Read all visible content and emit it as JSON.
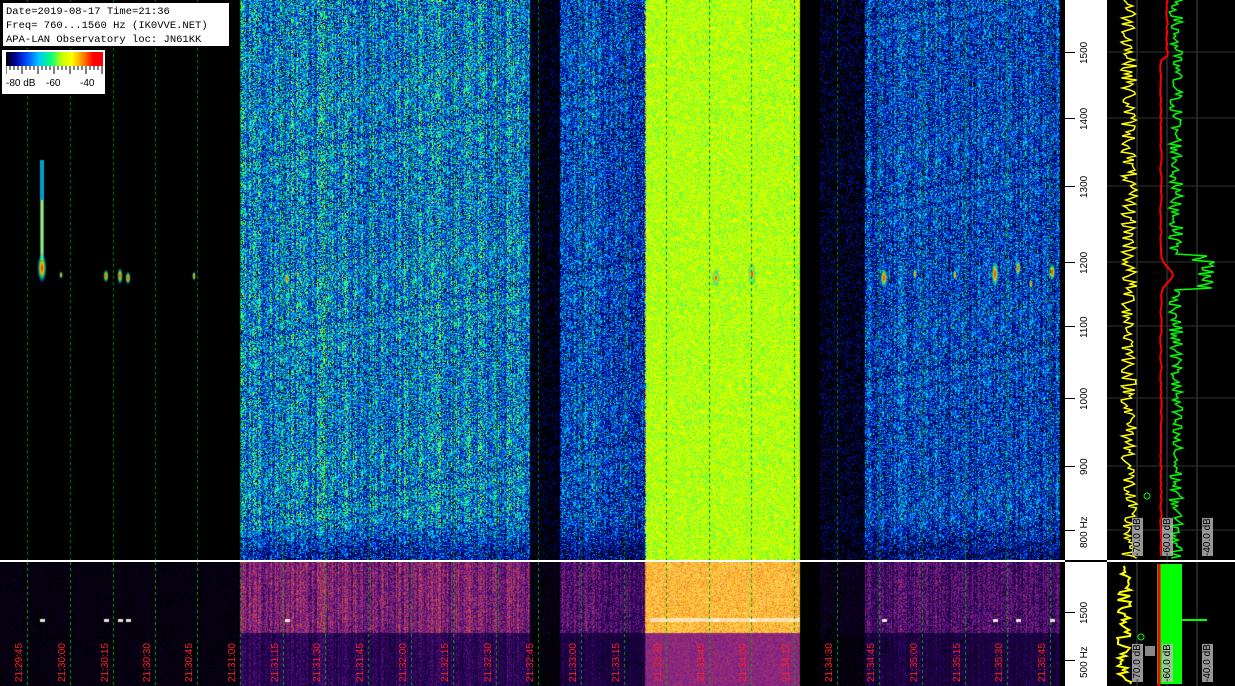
{
  "info": {
    "line1": "Date=2019-08-17 Time=21:36",
    "line2": "Freq= 760...1560 Hz (IK0VVE.NET)",
    "line3": "APA-LAN Observatory loc: JN61KK"
  },
  "scale": {
    "label_min": "-80 dB",
    "label_mid": "-60",
    "label_max": "-40"
  },
  "freq_axis": {
    "ticks": [
      "1500",
      "1400",
      "1300",
      "1200",
      "1100",
      "1000",
      "900",
      "800 Hz"
    ],
    "bottom_ticks": [
      "1500",
      "500 Hz"
    ]
  },
  "time_axis": {
    "labels": [
      "21:29:45",
      "21:30:00",
      "21:30:15",
      "21:30:30",
      "21:30:45",
      "21:31:00",
      "21:31:15",
      "21:31:30",
      "21:31:45",
      "21:32:00",
      "21:32:15",
      "21:32:30",
      "21:32:45",
      "21:33:00",
      "21:33:15",
      "21:33:30",
      "21:33:45",
      "21:34:00",
      "21:34:17",
      "21:34:30",
      "21:34:45",
      "21:35:00",
      "21:35:15",
      "21:35:30",
      "21:35:45"
    ]
  },
  "spectrum": {
    "labels": [
      "-70.0 dB",
      "-60.0 dB",
      "-40.0 dB"
    ],
    "bottom_labels": [
      "-70.0 dB",
      "-60.0 dB",
      "-40.0 dB"
    ],
    "colors": {
      "green": "#00ff00",
      "yellow": "#ffff00",
      "red": "#ff0000"
    }
  }
}
